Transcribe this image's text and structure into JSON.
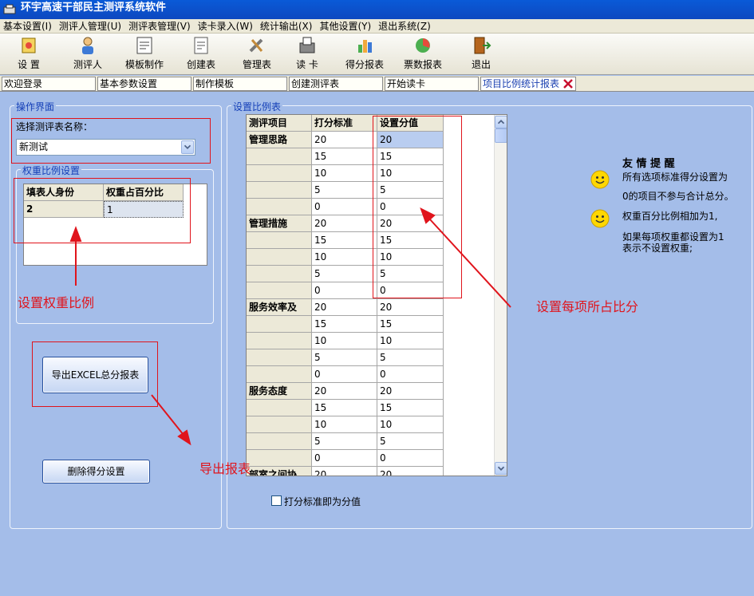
{
  "window": {
    "title": "环宇高速干部民主测评系统软件"
  },
  "menu": [
    "基本设置(I)",
    "测评人管理(U)",
    "测评表管理(V)",
    "读卡录入(W)",
    "统计输出(X)",
    "其他设置(Y)",
    "退出系统(Z)"
  ],
  "toolbar": [
    "设 置",
    "测评人",
    "模板制作",
    "创建表",
    "管理表",
    "读 卡",
    "得分报表",
    "票数报表",
    "退出"
  ],
  "tabs": [
    "欢迎登录",
    "基本参数设置",
    "制作模板",
    "创建测评表",
    "开始读卡",
    "项目比例统计报表"
  ],
  "left": {
    "group_title": "操作界面",
    "select_label": "选择测评表名称：",
    "select_value": "新测试",
    "weight_group": "权重比例设置",
    "weight_headers": [
      "填表人身份",
      "权重占百分比"
    ],
    "weight_rows": [
      [
        "2",
        "1"
      ]
    ],
    "export_button": "导出EXCEL总分报表",
    "delete_button": "删除得分设置"
  },
  "right": {
    "group_title": "设置比例表",
    "headers": [
      "测评项目",
      "打分标准",
      "设置分值"
    ],
    "rows": [
      [
        "管理思路",
        "20",
        "20"
      ],
      [
        "",
        "15",
        "15"
      ],
      [
        "",
        "10",
        "10"
      ],
      [
        "",
        "5",
        "5"
      ],
      [
        "",
        "0",
        "0"
      ],
      [
        "管理措施",
        "20",
        "20"
      ],
      [
        "",
        "15",
        "15"
      ],
      [
        "",
        "10",
        "10"
      ],
      [
        "",
        "5",
        "5"
      ],
      [
        "",
        "0",
        "0"
      ],
      [
        "服务效率及",
        "20",
        "20"
      ],
      [
        "",
        "15",
        "15"
      ],
      [
        "",
        "10",
        "10"
      ],
      [
        "",
        "5",
        "5"
      ],
      [
        "",
        "0",
        "0"
      ],
      [
        "服务态度",
        "20",
        "20"
      ],
      [
        "",
        "15",
        "15"
      ],
      [
        "",
        "10",
        "10"
      ],
      [
        "",
        "5",
        "5"
      ],
      [
        "",
        "0",
        "0"
      ],
      [
        "部室之间协",
        "20",
        "20"
      ]
    ],
    "checkbox_label": "打分标准即为分值"
  },
  "tips": {
    "title": "友 情 提 醒",
    "line1": "所有选项标准得分设置为",
    "line2": "0的项目不参与合计总分。",
    "line3": "权重百分比例相加为1,",
    "line4": "如果每项权重都设置为1",
    "line5": "表示不设置权重;"
  },
  "annotations": {
    "weight": "设置权重比例",
    "score": "设置每项所占比分",
    "export": "导出报表"
  },
  "colors": {
    "background": "#a4bde9",
    "title_bar": "#0a5ad8",
    "annotation": "#e0141c",
    "group_title": "#1540b8"
  }
}
